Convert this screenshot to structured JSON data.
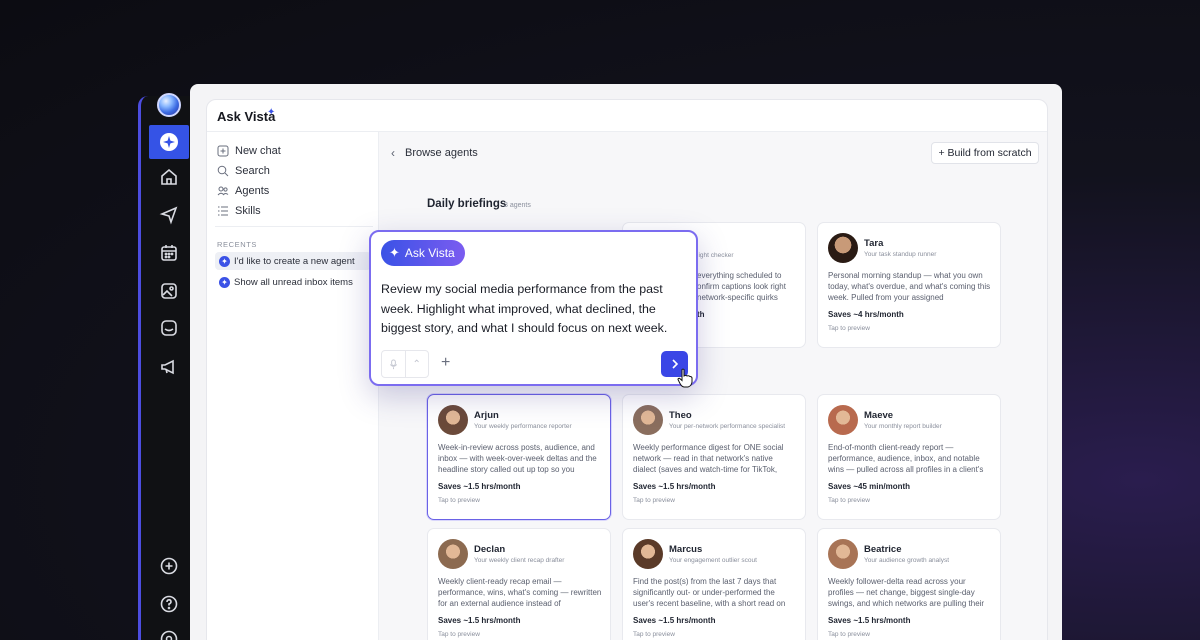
{
  "app": {
    "title": "Ask Vista"
  },
  "sidebar": {
    "items": [
      {
        "label": "New chat",
        "icon": "new-chat-icon"
      },
      {
        "label": "Search",
        "icon": "search-icon"
      },
      {
        "label": "Agents",
        "icon": "agents-icon"
      },
      {
        "label": "Skills",
        "icon": "skills-icon"
      }
    ],
    "recents_label": "RECENTS",
    "recents": [
      "I'd like to create a new agent",
      "Show all unread inbox items"
    ]
  },
  "content": {
    "back_label": "Browse agents",
    "build_label": "+ Build from scratch",
    "section_title": "Daily briefings",
    "section_count": "3 agents"
  },
  "top_cards": {
    "partial": {
      "role": "light checker",
      "desc": "everything scheduled to onfirm captions look right network-specific quirks",
      "saves": "th"
    },
    "tara": {
      "name": "Tara",
      "role": "Your task standup runner",
      "desc": "Personal morning standup — what you own today, what's overdue, and what's coming this week. Pulled from your assigned",
      "saves": "Saves ~4 hrs/month",
      "tap": "Tap to preview"
    }
  },
  "cards": [
    {
      "name": "Arjun",
      "role": "Your weekly performance reporter",
      "desc": "Week-in-review across posts, audience, and inbox — with week-over-week deltas and the headline story called out up top so you",
      "saves": "Saves ~1.5 hrs/month",
      "tap": "Tap to preview",
      "color": "#6b4a3a"
    },
    {
      "name": "Theo",
      "role": "Your per-network performance specialist",
      "desc": "Weekly performance digest for ONE social network — read in that network's native dialect (saves and watch-time for TikTok,",
      "saves": "Saves ~1.5 hrs/month",
      "tap": "Tap to preview",
      "color": "#8a6e5e"
    },
    {
      "name": "Maeve",
      "role": "Your monthly report builder",
      "desc": "End-of-month client-ready report — performance, audience, inbox, and notable wins — pulled across all profiles in a client's",
      "saves": "Saves ~45 min/month",
      "tap": "Tap to preview",
      "color": "#b86a4e"
    },
    {
      "name": "Declan",
      "role": "Your weekly client recap drafter",
      "desc": "Weekly client-ready recap email — performance, wins, what's coming — rewritten for an external audience instead of",
      "saves": "Saves ~1.5 hrs/month",
      "tap": "Tap to preview",
      "color": "#8c6a50"
    },
    {
      "name": "Marcus",
      "role": "Your engagement outlier scout",
      "desc": "Find the post(s) from the last 7 days that significantly out- or under-performed the user's recent baseline, with a short read on",
      "saves": "Saves ~1.5 hrs/month",
      "tap": "Tap to preview",
      "color": "#5a3a28"
    },
    {
      "name": "Beatrice",
      "role": "Your audience growth analyst",
      "desc": "Weekly follower-delta read across your profiles — net change, biggest single-day swings, and which networks are pulling their",
      "saves": "Saves ~1.5 hrs/month",
      "tap": "Tap to preview",
      "color": "#a87456"
    }
  ],
  "popup": {
    "pill_label": "Ask Vista",
    "prompt": "Review my social media performance from the past week. Highlight what improved, what declined, the biggest story, and what I should focus on next week."
  },
  "colors": {
    "accent": "#3a52e6",
    "highlight": "#7b6cf0"
  }
}
